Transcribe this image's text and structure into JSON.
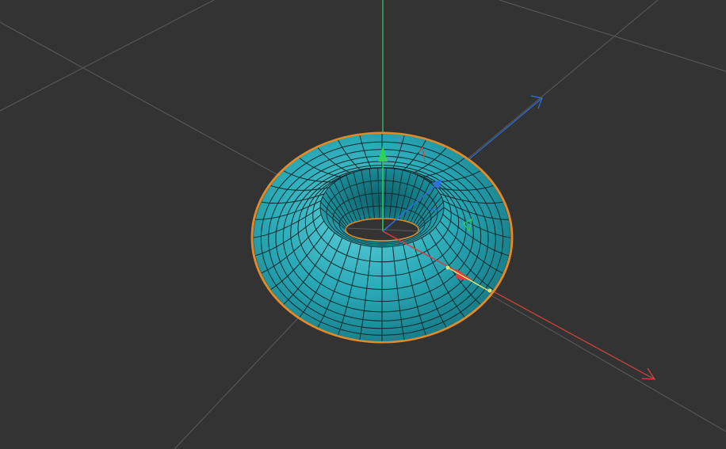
{
  "viewport": {
    "background_color": "#333333",
    "grid": {
      "visible": true,
      "line_color": "#5a5a5a"
    },
    "axes": {
      "x_color": "#d8443c",
      "y_color": "#3fcf6a",
      "z_color": "#2f6fd8"
    },
    "object": {
      "type": "torus",
      "surface_color": "#2aa9b6",
      "wire_color": "#0b2a2e",
      "selected": true,
      "selection_outline_color": "#e08a2a"
    },
    "gizmo": {
      "mode": "translate",
      "x_handle_color": "#e03a3a",
      "y_handle_color": "#2ed15a",
      "z_handle_color": "#2f6fe0",
      "plane_handle_color": "#e8e06a"
    }
  }
}
